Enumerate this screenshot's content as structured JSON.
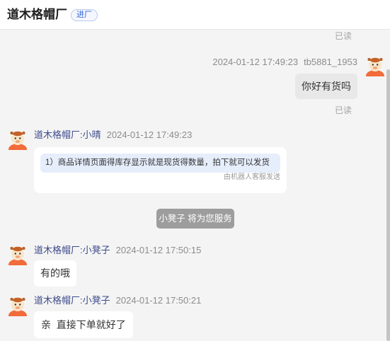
{
  "header": {
    "title": "道木格帽厂",
    "badge": "进厂"
  },
  "colors": {
    "sender_name": "#3e4b8b",
    "badge_text": "#2f63d6",
    "system_notice_bg": "#9d9d9d",
    "card_item_bg": "#e6eefc"
  },
  "icons": {
    "avatar": "cartoon-bull-avatar"
  },
  "top_status": "已读",
  "messages": [
    {
      "time": "2024-01-12 17:49:23",
      "sender": "tb5881_1953",
      "text": "你好有货吗",
      "status": "已读"
    },
    {
      "sender": "道木格帽厂:小晴",
      "time": "2024-01-12 17:49:23",
      "card_item": "1）商品详情页面得库存显示就是现货得数量，拍下就可以发货",
      "card_footnote": "由机器人客服发送"
    },
    {
      "sender": "道木格帽厂:小凳子",
      "time": "2024-01-12 17:50:15",
      "text": "有的哦"
    },
    {
      "sender": "道木格帽厂:小凳子",
      "time": "2024-01-12 17:50:21",
      "text": "亲  直接下单就好了"
    }
  ],
  "system_notice": "小凳子 将为您服务"
}
